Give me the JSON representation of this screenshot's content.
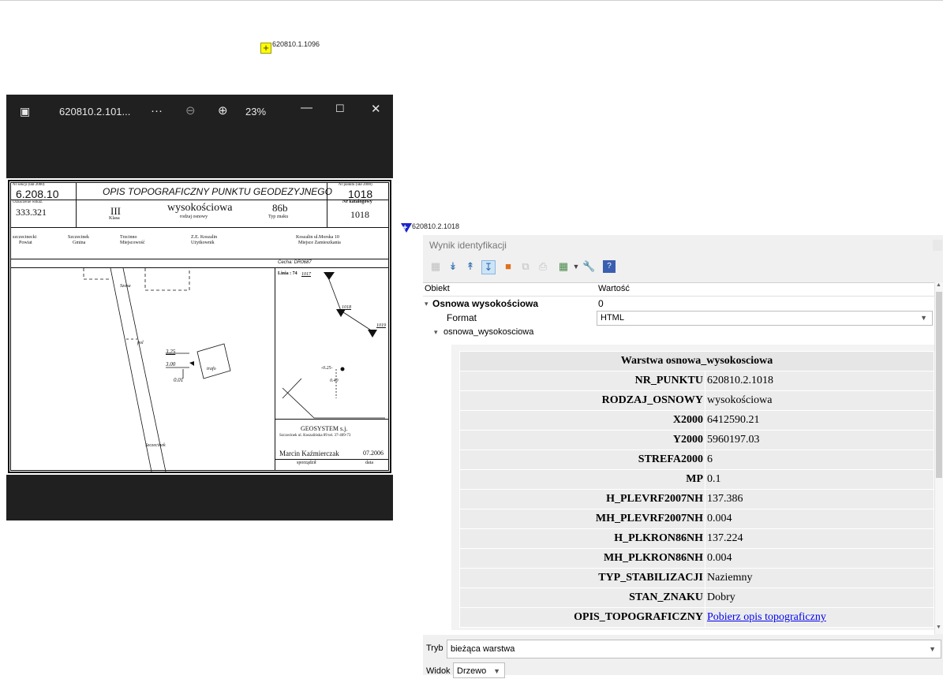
{
  "map": {
    "point1_label": "620810.1.1096",
    "point2_label": "620810.2.1018"
  },
  "viewer": {
    "filename": "620810.2.101...",
    "more": "···",
    "zoom": "23%",
    "doc": {
      "nr_sekcji_caption": "Nr sekcji (ukł 2000)",
      "nr_sekcji": "6.208.10",
      "title": "OPIS TOPOGRAFICZNY PUNKTU GEODEZYJNEGO",
      "nr_punktu_caption": "Nr punktu (ukł 2000)",
      "nr_punktu": "1018",
      "oznaczenie_caption": "Oznaczenie wskaz.",
      "oznaczenie": "333.321",
      "klasa": "III",
      "klasa_caption": "Klasa",
      "rodzaj": "wysokościowa",
      "rodzaj_caption": "rodzaj osnowy",
      "typ": "86b",
      "typ_caption": "Typ znaku",
      "nr_katalog_caption": "Nr katalogowy",
      "nr_katalog": "1018",
      "powiat": "szczecinecki",
      "powiat_caption": "Powiat",
      "gmina": "Szczecinek",
      "gmina_caption": "Gmina",
      "miejscowosc": "Trzcinno",
      "miejscowosc_caption": "Miejscowość",
      "uzytkownik": "Z.E. Koszalin",
      "uzytkownik_caption": "Użytkownik",
      "adres": "Koszalin ul.Morska 10",
      "adres_caption": "Miejsce Zamieszkania",
      "cecha": "Cecha: DR0687",
      "linia": "Linia : 74",
      "sketch_p1": "1017",
      "sketch_p2": "1018",
      "sketch_p3": "1019",
      "sketch_d1": "-0.25-",
      "sketch_d2": "0.40",
      "sketch_road": "Szosa",
      "sketch_pol": "pol",
      "sketch_road2": "Szczecinek",
      "dim1": "3.25",
      "dim2": "3.00",
      "dim3": "0.01",
      "trafo": "trafo",
      "firm": "GEOSYSTEM s.j.",
      "firm_addr": "Szczecinek ul. Koszalińska 89 tel. 37-409-73",
      "author": "Marcin Kaźmierczak",
      "date": "07.2006",
      "author_caption": "sporządził",
      "date_caption": "data"
    }
  },
  "panel": {
    "title": "Wynik identyfikacji",
    "col_object": "Obiekt",
    "col_value": "Wartość",
    "layer_name": "Osnowa wysokościowa",
    "layer_value": "0",
    "format_label": "Format",
    "format_value": "HTML",
    "feature_name": "osnowa_wysokosciowa",
    "table_title": "Warstwa osnowa_wysokosciowa",
    "attributes": [
      {
        "k": "NR_PUNKTU",
        "v": "620810.2.1018"
      },
      {
        "k": "RODZAJ_OSNOWY",
        "v": "wysokościowa"
      },
      {
        "k": "X2000",
        "v": "6412590.21"
      },
      {
        "k": "Y2000",
        "v": "5960197.03"
      },
      {
        "k": "STREFA2000",
        "v": "6"
      },
      {
        "k": "MP",
        "v": "0.1"
      },
      {
        "k": "H_PLEVRF2007NH",
        "v": "137.386"
      },
      {
        "k": "MH_PLEVRF2007NH",
        "v": "0.004"
      },
      {
        "k": "H_PLKRON86NH",
        "v": "137.224"
      },
      {
        "k": "MH_PLKRON86NH",
        "v": "0.004"
      },
      {
        "k": "TYP_STABILIZACJI",
        "v": "Naziemny"
      },
      {
        "k": "STAN_ZNAKU",
        "v": "Dobry"
      },
      {
        "k": "OPIS_TOPOGRAFICZNY",
        "v": "Pobierz opis topograficzny"
      }
    ],
    "tryb_label": "Tryb",
    "tryb_value": "bieżąca warstwa",
    "widok_label": "Widok",
    "widok_value": "Drzewo"
  },
  "colors": {
    "link": "#0000ee",
    "marker_yellow": "#ffff00",
    "marker_blue": "#1a24c8"
  }
}
